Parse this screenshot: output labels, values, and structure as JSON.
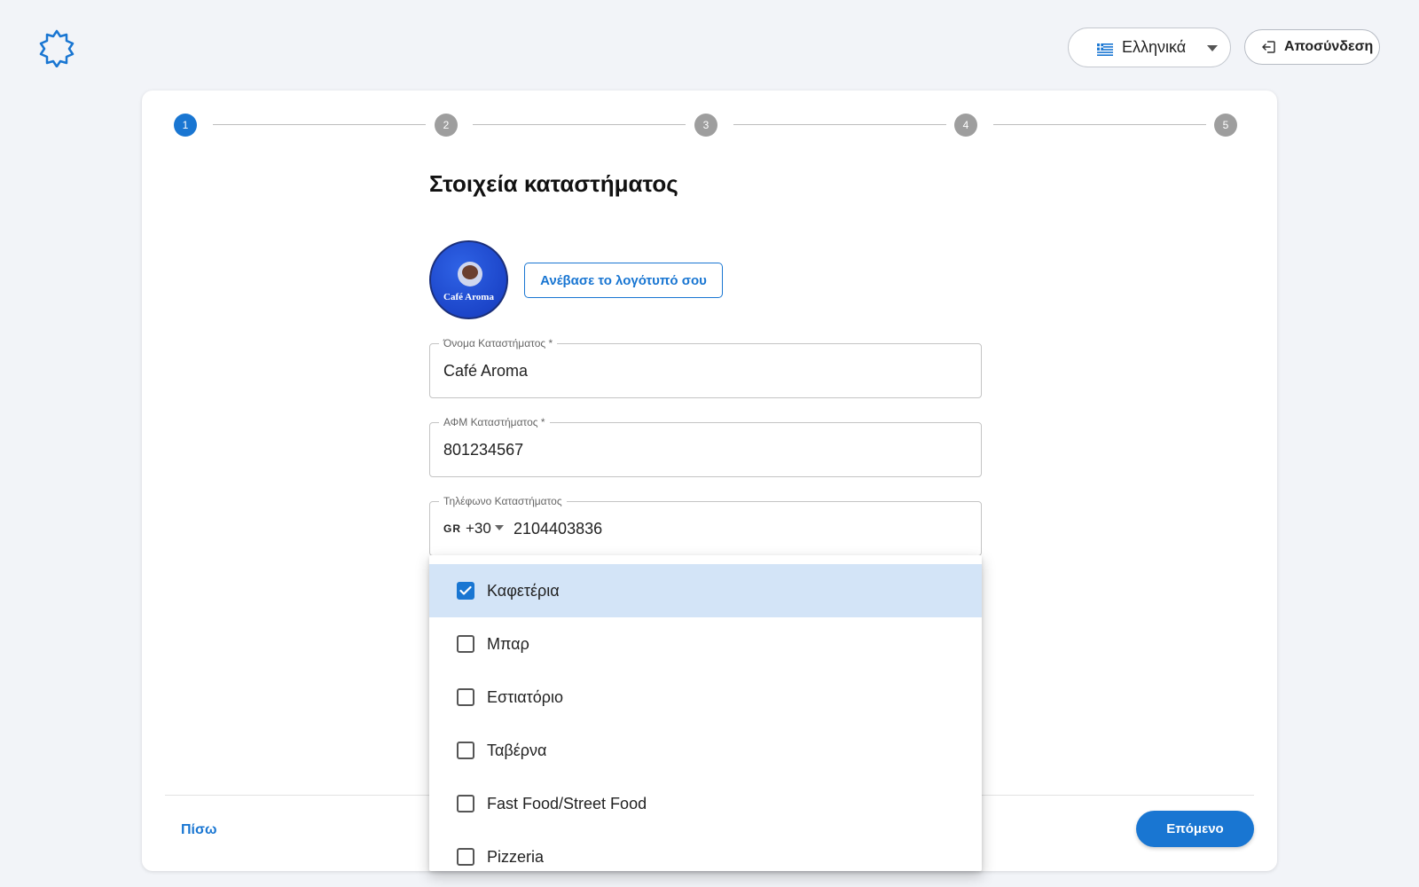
{
  "header": {
    "language_label": "Ελληνικά",
    "logout_label": "Αποσύνδεση"
  },
  "stepper": {
    "steps": [
      "1",
      "2",
      "3",
      "4",
      "5"
    ],
    "active_step": 1
  },
  "form": {
    "title": "Στοιχεία καταστήματος",
    "logo_text": "Café Aroma",
    "upload_label": "Ανέβασε το λογότυπό σου",
    "store_name": {
      "label": "Όνομα Καταστήματος *",
      "value": "Café Aroma"
    },
    "vat": {
      "label": "ΑΦΜ Καταστήματος *",
      "value": "801234567"
    },
    "phone": {
      "label": "Τηλέφωνο Καταστήματος",
      "country_code": "GR",
      "prefix": "+30",
      "number": "2104403836"
    }
  },
  "dropdown": {
    "options": [
      {
        "label": "Καφετέρια",
        "checked": true
      },
      {
        "label": "Μπαρ",
        "checked": false
      },
      {
        "label": "Εστιατόριο",
        "checked": false
      },
      {
        "label": "Ταβέρνα",
        "checked": false
      },
      {
        "label": "Fast Food/Street Food",
        "checked": false
      },
      {
        "label": "Pizzeria",
        "checked": false
      }
    ]
  },
  "footer": {
    "back_label": "Πίσω",
    "next_label": "Επόμενο"
  },
  "colors": {
    "accent": "#1976d2",
    "selected_bg": "#d3e4f7",
    "page_bg": "#f2f4f8"
  }
}
